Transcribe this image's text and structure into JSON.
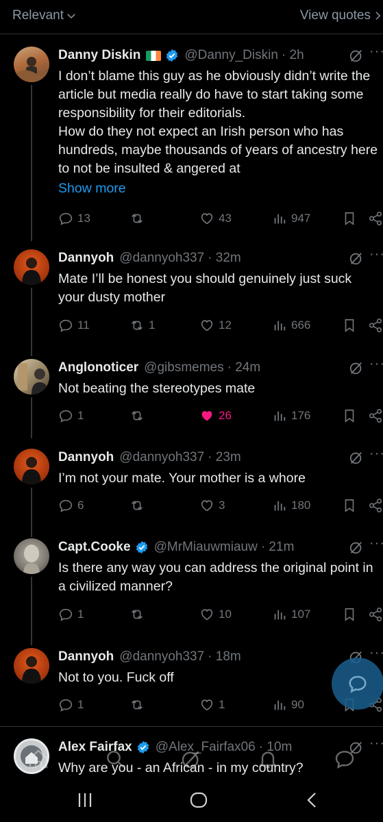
{
  "topbar": {
    "sort_label": "Relevant",
    "view_quotes_label": "View quotes"
  },
  "tweets": [
    {
      "name": "Danny Diskin",
      "handle": "@Danny_Diskin",
      "time": "· 2h",
      "text": "I don’t blame this guy as he obviously didn’t write the article but media really do have to start taking some responsibility for their editorials.\nHow do they not expect an Irish person who has hundreds, maybe thousands of years of ancestry here to not be insulted & angered at",
      "show_more": "Show more",
      "replies": "13",
      "retweets": "",
      "likes": "43",
      "views": "947"
    },
    {
      "name": "Dannyoh",
      "handle": "@dannyoh337",
      "time": "· 32m",
      "text": "Mate I’ll be honest you should genuinely just suck your dusty mother",
      "replies": "11",
      "retweets": "1",
      "likes": "12",
      "views": "666"
    },
    {
      "name": "Anglonoticer",
      "handle": "@gibsmemes",
      "time": "· 24m",
      "text": "Not beating the stereotypes mate",
      "replies": "1",
      "retweets": "",
      "likes": "26",
      "views": "176"
    },
    {
      "name": "Dannyoh",
      "handle": "@dannyoh337",
      "time": "· 23m",
      "text": "I’m not your mate. Your mother is a whore",
      "replies": "6",
      "retweets": "",
      "likes": "3",
      "views": "180"
    },
    {
      "name": "Capt.Cooke",
      "handle": "@MrMiauwmiauw",
      "time": "· 21m",
      "text": "Is there any way you can address the original point in a civilized manner?",
      "replies": "1",
      "retweets": "",
      "likes": "10",
      "views": "107"
    },
    {
      "name": "Dannyoh",
      "handle": "@dannyoh337",
      "time": "· 18m",
      "text": "Not to you. Fuck off",
      "replies": "1",
      "retweets": "",
      "likes": "1",
      "views": "90"
    },
    {
      "name": "Alex Fairfax",
      "handle": "@Alex_Fairfax06",
      "time": "· 10m",
      "text": "Why are you - an African - in my country?"
    }
  ],
  "colors": {
    "accent": "#1d9bf0",
    "like": "#f91880",
    "muted": "#71767b",
    "text": "#e7e9ea",
    "irish_flag": [
      "#169b62",
      "#ffffff",
      "#ff883e"
    ]
  },
  "icons": [
    "chevron-down-icon",
    "chevron-right-icon",
    "verified-badge-icon",
    "grok-icon",
    "more-icon",
    "reply-icon",
    "retweet-icon",
    "like-icon",
    "views-icon",
    "bookmark-icon",
    "share-icon",
    "compose-reply-icon",
    "home-icon",
    "search-icon",
    "grok-nav-icon",
    "notifications-icon",
    "messages-icon",
    "recents-icon",
    "home-button-icon",
    "back-icon"
  ]
}
